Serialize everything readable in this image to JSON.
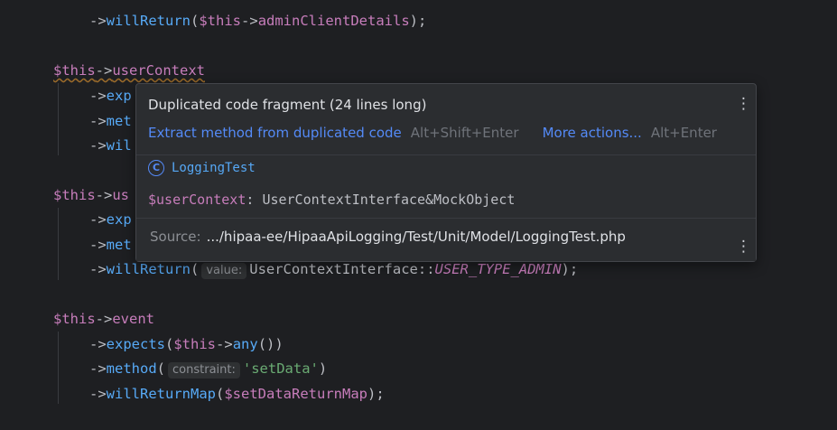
{
  "editor": {
    "lines": {
      "l1": {
        "arrow": "->",
        "fn": "willReturn",
        "open": "(",
        "var": "$this",
        "arrow2": "->",
        "prop": "adminClientDetails",
        "close": ");"
      },
      "l2": {
        "var": "$this",
        "arrow": "->",
        "prop": "userContext"
      },
      "l3": {
        "arrow": "->",
        "fn": "exp"
      },
      "l4": {
        "arrow": "->",
        "fn": "met"
      },
      "l5": {
        "arrow": "->",
        "fn": "wil"
      },
      "l6": {
        "var": "$this",
        "arrow": "->",
        "prop": "us"
      },
      "l7": {
        "arrow": "->",
        "fn": "exp"
      },
      "l8": {
        "arrow": "->",
        "fn": "met"
      },
      "l9": {
        "arrow": "->",
        "fn": "willReturn",
        "open": "(",
        "hint": "value:",
        "cls": "UserContextInterface",
        "dc": "::",
        "const": "USER_TYPE_ADMIN",
        "close": ");"
      },
      "l10": {
        "var": "$this",
        "arrow": "->",
        "prop": "event"
      },
      "l11": {
        "arrow": "->",
        "fn": "expects",
        "open": "(",
        "var": "$this",
        "arrow2": "->",
        "fn2": "any",
        "close": "())"
      },
      "l12": {
        "arrow": "->",
        "fn": "method",
        "open": "(",
        "hint": "constraint:",
        "str": "'setData'",
        "close": ")"
      },
      "l13": {
        "arrow": "->",
        "fn": "willReturnMap",
        "open": "(",
        "var": "$setDataReturnMap",
        "close": ");"
      }
    }
  },
  "popup": {
    "title": "Duplicated code fragment (24 lines long)",
    "extract_action": "Extract method from duplicated code",
    "extract_shortcut": "Alt+Shift+Enter",
    "more_action": "More actions...",
    "more_shortcut": "Alt+Enter",
    "class_icon": "C",
    "class_name": "LoggingTest",
    "sig_var": "$userContext",
    "sig_colon": ":",
    "sig_type": "UserContextInterface&MockObject",
    "source_label": "Source:",
    "source_path": ".../hipaa-ee/HipaaApiLogging/Test/Unit/Model/LoggingTest.php"
  },
  "colors": {
    "background": "#1e1f22",
    "popup_bg": "#2b2d30",
    "link": "#548af7",
    "variable": "#c77dbb",
    "function": "#57aaf7",
    "string": "#6aab73"
  }
}
